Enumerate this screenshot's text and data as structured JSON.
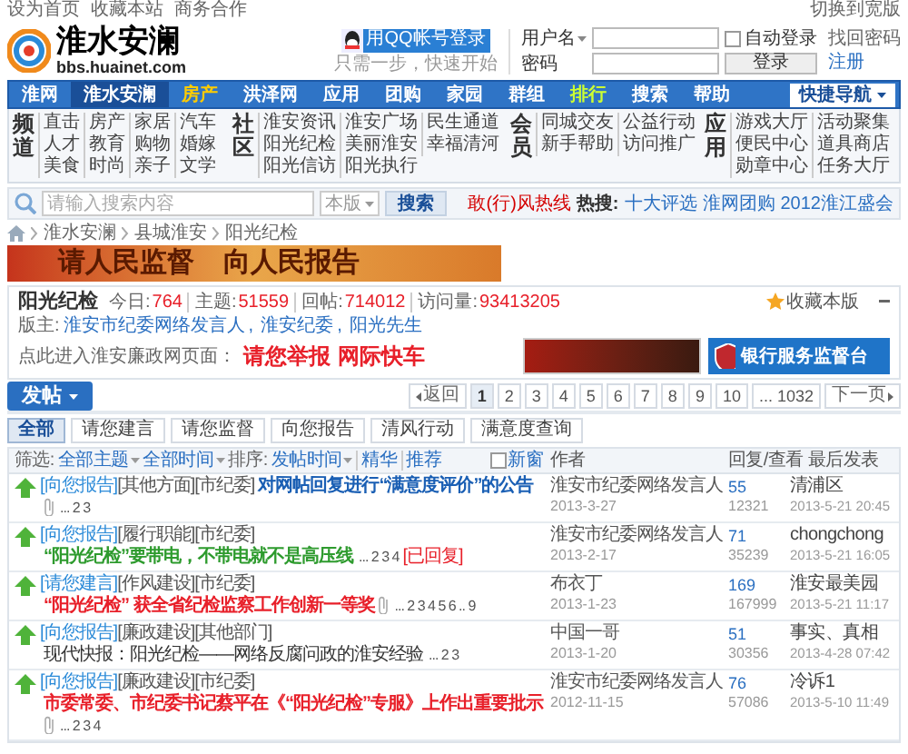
{
  "top_links": [
    "设为首页",
    "收藏本站",
    "商务合作"
  ],
  "layout_switch": "切换到宽版",
  "logo": {
    "title": "淮水安澜",
    "url": "bbs.huainet.com"
  },
  "qq_login": {
    "label": "用QQ帐号登录",
    "hint": "只需一步，快速开始"
  },
  "login": {
    "username_label": "用户名",
    "password_label": "密码",
    "auto_login": {
      "label": "自动登录",
      "checked": false
    },
    "forgot": "找回密码",
    "submit": "登录",
    "register": "注册"
  },
  "nav": [
    {
      "label": "淮网",
      "selected": false,
      "kind": "plain"
    },
    {
      "label": "淮水安澜",
      "selected": true,
      "kind": "plain"
    },
    {
      "label": "房产",
      "selected": false,
      "kind": "hot"
    },
    {
      "label": "洪泽网",
      "selected": false,
      "kind": "plain"
    },
    {
      "label": "应用",
      "selected": false,
      "kind": "plain"
    },
    {
      "label": "团购",
      "selected": false,
      "kind": "plain"
    },
    {
      "label": "家园",
      "selected": false,
      "kind": "plain"
    },
    {
      "label": "群组",
      "selected": false,
      "kind": "plain"
    },
    {
      "label": "排行",
      "selected": false,
      "kind": "rank"
    },
    {
      "label": "搜索",
      "selected": false,
      "kind": "plain"
    },
    {
      "label": "帮助",
      "selected": false,
      "kind": "plain"
    }
  ],
  "quick_nav": "快捷导航",
  "channels": [
    {
      "heading": "频道",
      "items": [
        "直击",
        "房产",
        "家居",
        "汽车",
        "人才",
        "教育",
        "购物",
        "婚嫁",
        "美食",
        "时尚",
        "亲子",
        "文学"
      ]
    },
    {
      "heading": "社区",
      "items": [
        "淮安资讯",
        "淮安广场",
        "民生通道",
        "阳光纪检",
        "美丽淮安",
        "幸福清河",
        "阳光信访",
        "阳光执行"
      ]
    },
    {
      "heading": "会员",
      "items": [
        "同城交友",
        "公益行动",
        "新手帮助",
        "访问推广"
      ]
    },
    {
      "heading": "应用",
      "items": [
        "游戏大厅",
        "活动聚集",
        "便民中心",
        "道具商店",
        "勋章中心",
        "任务大厅"
      ]
    }
  ],
  "search": {
    "placeholder": "请输入搜索内容",
    "scope": "本版",
    "button": "搜索",
    "hotline": "敢(行)风热线",
    "hot_label": "热搜:",
    "hot": [
      "十大评选",
      "淮网团购",
      "2012淮江盛会"
    ]
  },
  "breadcrumb": [
    "淮水安澜",
    "县城淮安",
    "阳光纪检"
  ],
  "banner": [
    "请人民监督",
    "向人民报告"
  ],
  "forum": {
    "name": "阳光纪检",
    "stats": [
      {
        "label": "今日:",
        "value": "764"
      },
      {
        "label": "主题:",
        "value": "51559"
      },
      {
        "label": "回帖:",
        "value": "714012"
      },
      {
        "label": "访问量:",
        "value": "93413205"
      }
    ],
    "favorite": "收藏本版",
    "moderators_label": "版主:",
    "moderators": [
      "淮安市纪委网络发言人",
      "淮安纪委",
      "阳光先生"
    ],
    "moderator_separator": ",",
    "link_label": "点此进入淮安廉政网页面：",
    "links": [
      "请您举报",
      "网际快车"
    ],
    "ads": [
      {
        "kind": "photo"
      },
      {
        "kind": "emblem",
        "text": "银行服务监督台"
      }
    ]
  },
  "post_button": "发帖",
  "pagination": {
    "prev": "返回",
    "pages": [
      {
        "label": "1",
        "selected": true
      },
      {
        "label": "2",
        "selected": false
      },
      {
        "label": "3",
        "selected": false
      },
      {
        "label": "4",
        "selected": false
      },
      {
        "label": "5",
        "selected": false
      },
      {
        "label": "6",
        "selected": false
      },
      {
        "label": "7",
        "selected": false
      },
      {
        "label": "8",
        "selected": false
      },
      {
        "label": "9",
        "selected": false
      },
      {
        "label": "10",
        "selected": false
      },
      {
        "label": "... 1032",
        "selected": false
      }
    ],
    "next": "下一页"
  },
  "tabs": [
    {
      "label": "全部",
      "selected": true
    },
    {
      "label": "请您建言",
      "selected": false
    },
    {
      "label": "请您监督",
      "selected": false
    },
    {
      "label": "向您报告",
      "selected": false
    },
    {
      "label": "清风行动",
      "selected": false
    },
    {
      "label": "满意度查询",
      "selected": false
    }
  ],
  "table": {
    "filter_label": "筛选:",
    "filters": [
      "全部主题",
      "全部时间"
    ],
    "sort_label": "排序:",
    "sort": "发帖时间",
    "extras": [
      "精华",
      "推荐"
    ],
    "new_window": {
      "label": "新窗",
      "checked": false
    },
    "columns": [
      "作者",
      "回复/查看",
      "最后发表"
    ],
    "rows": [
      {
        "tags": [
          "[向您报告]",
          "[其他方面]",
          "[市纪委]"
        ],
        "title": "对网帖回复进行“满意度评价”的公告",
        "color": "#1a5fb4",
        "bold": true,
        "attachment": true,
        "pages": "... 2 3",
        "author": "淮安市纪委网络发言人",
        "date": "2013-3-27",
        "replies": "55",
        "views": "12321",
        "last_user": "清浦区",
        "last_time": "2013-5-21 20:45"
      },
      {
        "tags": [
          "[向您报告]",
          "[履行职能]",
          "[市纪委]"
        ],
        "title": "“阳光纪检”要带电，不带电就不是高压线",
        "color": "#2e9b2e",
        "bold": true,
        "attachment": false,
        "pages": "... 2 3 4",
        "badge": "[已回复]",
        "author": "淮安市纪委网络发言人",
        "date": "2013-2-17",
        "replies": "71",
        "views": "35239",
        "last_user": "chongchong",
        "last_time": "2013-5-21 16:05"
      },
      {
        "tags": [
          "[请您建言]",
          "[作风建设]",
          "[市纪委]"
        ],
        "title": "“阳光纪检” 获全省纪检监察工作创新一等奖",
        "color": "#e8202a",
        "bold": true,
        "attachment": true,
        "pages": "... 2 3 4 5 6 .. 9",
        "author": "布衣丁",
        "date": "2013-1-23",
        "replies": "169",
        "views": "167999",
        "last_user": "淮安最美园",
        "last_time": "2013-5-21 11:17"
      },
      {
        "tags": [
          "[向您报告]",
          "[廉政建设]",
          "[其他部门]"
        ],
        "title": "现代快报：阳光纪检——网络反腐问政的淮安经验",
        "color": "#333333",
        "bold": false,
        "attachment": false,
        "pages": "... 2 3",
        "author": "中国一哥",
        "date": "2013-1-20",
        "replies": "51",
        "views": "30356",
        "last_user": "事实、真相",
        "last_time": "2013-4-28 07:42"
      },
      {
        "tags": [
          "[向您报告]",
          "[廉政建设]",
          "[市纪委]"
        ],
        "title": "市委常委、市纪委书记蔡平在《“阳光纪检”专服》上作出重要批示",
        "color": "#e8202a",
        "bold": true,
        "attachment": true,
        "pages": "... 2 3 4",
        "author": "淮安市纪委网络发言人",
        "date": "2012-11-15",
        "replies": "76",
        "views": "57086",
        "last_user": "冷诉1",
        "last_time": "2013-5-10 11:49"
      }
    ]
  }
}
